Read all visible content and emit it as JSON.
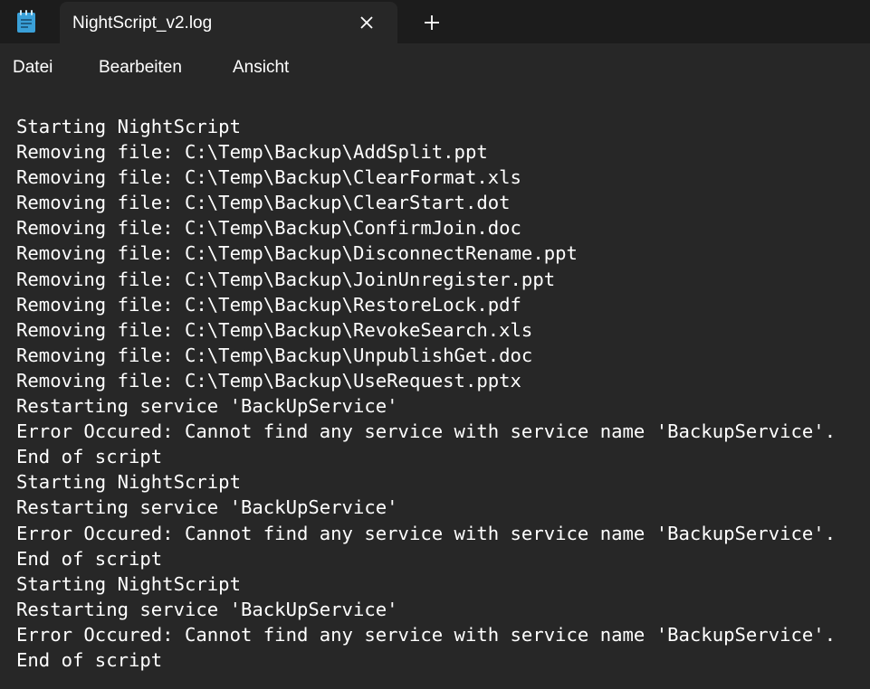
{
  "window": {
    "app_icon": "notepad-icon",
    "tab": {
      "title": "NightScript_v2.log",
      "close_icon": "close-icon"
    },
    "new_tab_icon": "plus-icon"
  },
  "menu": {
    "items": [
      "Datei",
      "Bearbeiten",
      "Ansicht"
    ]
  },
  "editor": {
    "lines": [
      "Starting NightScript",
      "Removing file: C:\\Temp\\Backup\\AddSplit.ppt",
      "Removing file: C:\\Temp\\Backup\\ClearFormat.xls",
      "Removing file: C:\\Temp\\Backup\\ClearStart.dot",
      "Removing file: C:\\Temp\\Backup\\ConfirmJoin.doc",
      "Removing file: C:\\Temp\\Backup\\DisconnectRename.ppt",
      "Removing file: C:\\Temp\\Backup\\JoinUnregister.ppt",
      "Removing file: C:\\Temp\\Backup\\RestoreLock.pdf",
      "Removing file: C:\\Temp\\Backup\\RevokeSearch.xls",
      "Removing file: C:\\Temp\\Backup\\UnpublishGet.doc",
      "Removing file: C:\\Temp\\Backup\\UseRequest.pptx",
      "Restarting service 'BackUpService'",
      "Error Occured: Cannot find any service with service name 'BackupService'.",
      "End of script",
      "Starting NightScript",
      "Restarting service 'BackUpService'",
      "Error Occured: Cannot find any service with service name 'BackupService'.",
      "End of script",
      "Starting NightScript",
      "Restarting service 'BackUpService'",
      "Error Occured: Cannot find any service with service name 'BackupService'.",
      "End of script"
    ]
  },
  "colors": {
    "titlebar_bg": "#1c1c1c",
    "editor_bg": "#272727",
    "text": "#ffffff",
    "icon_accent": "#3aa0d8"
  }
}
